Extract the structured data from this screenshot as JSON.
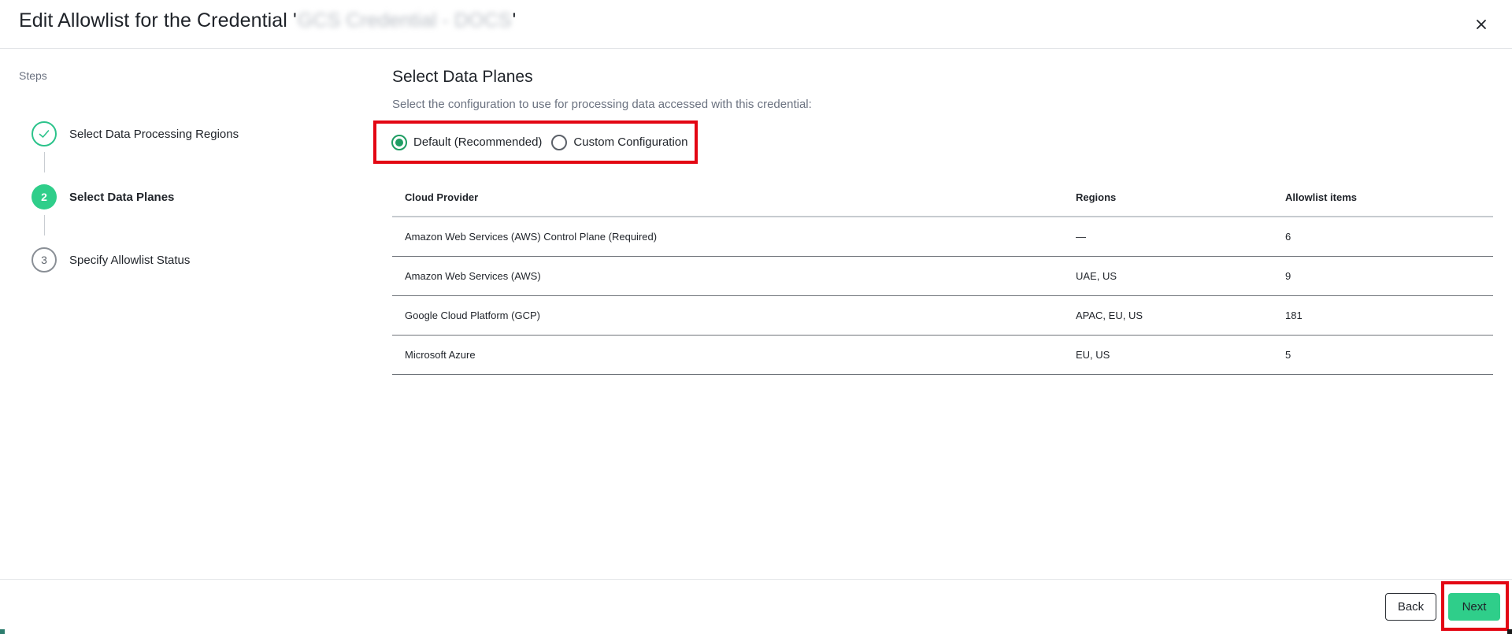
{
  "header": {
    "title_prefix": "Edit Allowlist for the Credential '",
    "title_redacted": "GCS Credential - DOCS",
    "title_suffix": "'",
    "close_icon": "close-icon"
  },
  "steps": {
    "label": "Steps",
    "items": [
      {
        "number": "1",
        "label": "Select Data Processing Regions",
        "state": "done"
      },
      {
        "number": "2",
        "label": "Select Data Planes",
        "state": "active"
      },
      {
        "number": "3",
        "label": "Specify Allowlist Status",
        "state": "todo"
      }
    ]
  },
  "main": {
    "title": "Select Data Planes",
    "description": "Select the configuration to use for processing data accessed with this credential:",
    "options": [
      {
        "label": "Default (Recommended)",
        "checked": true
      },
      {
        "label": "Custom Configuration",
        "checked": false
      }
    ],
    "table": {
      "headers": [
        "Cloud Provider",
        "Regions",
        "Allowlist items"
      ],
      "rows": [
        [
          "Amazon Web Services (AWS) Control Plane (Required)",
          "—",
          "6"
        ],
        [
          "Amazon Web Services (AWS)",
          "UAE, US",
          "9"
        ],
        [
          "Google Cloud Platform (GCP)",
          "APAC, EU, US",
          "181"
        ],
        [
          "Microsoft Azure",
          "EU, US",
          "5"
        ]
      ]
    }
  },
  "footer": {
    "back_label": "Back",
    "next_label": "Next"
  },
  "colors": {
    "accent_green": "#2fce8a",
    "highlight_red": "#e30613",
    "radio_green": "#1f9d63"
  }
}
